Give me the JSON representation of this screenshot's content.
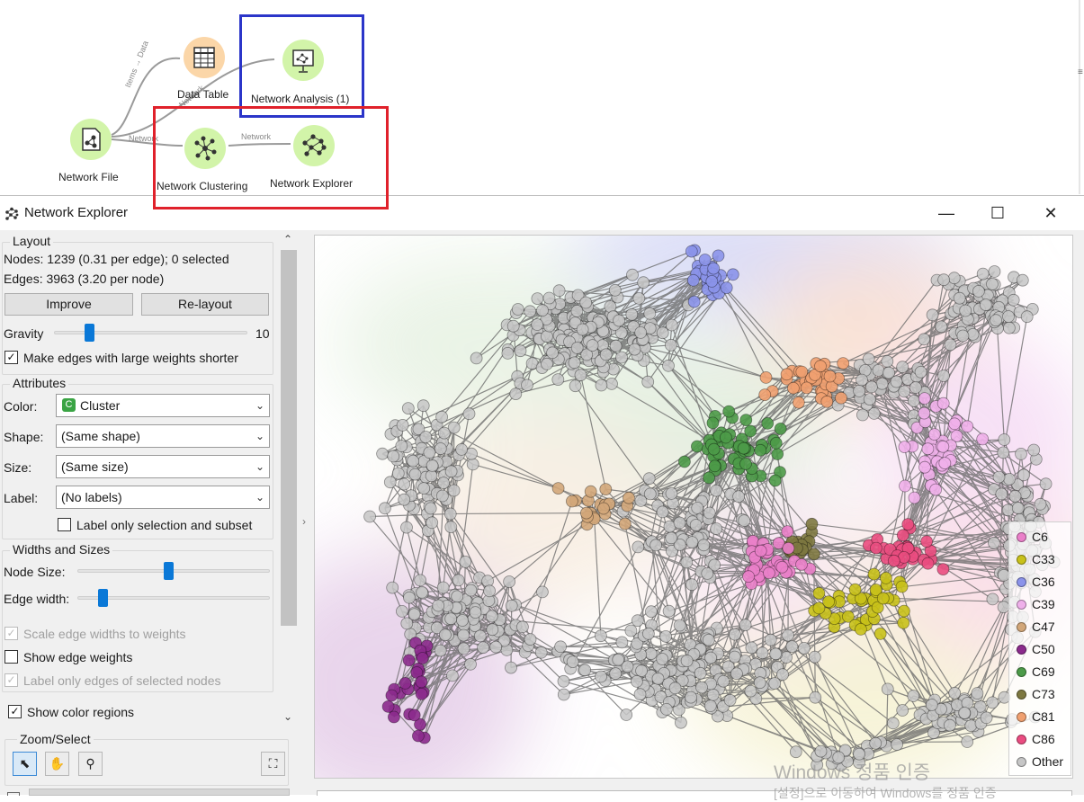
{
  "workflow": {
    "nodes": [
      {
        "label": "Data Table",
        "icon": "table-icon"
      },
      {
        "label": "Network Analysis (1)",
        "icon": "network-analysis-icon"
      },
      {
        "label": "Network File",
        "icon": "network-file-icon"
      },
      {
        "label": "Network Clustering",
        "icon": "network-clustering-icon"
      },
      {
        "label": "Network Explorer",
        "icon": "network-explorer-icon"
      }
    ],
    "links": {
      "file_to_table": "Items → Data",
      "file_to_analysis": "Network",
      "file_to_clustering": "Network",
      "clustering_to_explorer": "Network"
    },
    "highlight_colors": {
      "blue_box": "#2b35c9",
      "red_box": "#e0212b"
    }
  },
  "window": {
    "title": "Network Explorer",
    "icon": "network-explorer-icon",
    "controls": {
      "minimize": "—",
      "maximize": "☐",
      "close": "✕"
    }
  },
  "layout_box": {
    "title": "Layout",
    "nodes_info": "Nodes: 1239 (0.31 per edge); 0 selected",
    "edges_info": "Edges: 3963 (3.20 per node)",
    "improve_label": "Improve",
    "relayout_label": "Re-layout",
    "gravity_label": "Gravity",
    "gravity_value": "10",
    "gravity_fraction": 0.1,
    "shorter_edges_label": "Make edges with large weights shorter",
    "shorter_edges_checked": true
  },
  "attributes_box": {
    "title": "Attributes",
    "color_label": "Color:",
    "color_value": "Cluster",
    "color_badge": "C",
    "shape_label": "Shape:",
    "shape_value": "(Same shape)",
    "size_label": "Size:",
    "size_value": "(Same size)",
    "label_label": "Label:",
    "label_value": "(No labels)",
    "label_only_selection": "Label only selection and subset",
    "label_only_selection_checked": false
  },
  "widths_box": {
    "title": "Widths and Sizes",
    "node_size_label": "Node Size:",
    "node_size_fraction": 0.47,
    "edge_width_label": "Edge width:",
    "edge_width_fraction": 0.1,
    "scale_edges_label": "Scale edge widths to weights",
    "scale_edges_checked": true,
    "show_weights_label": "Show edge weights",
    "show_weights_checked": false,
    "label_edges_label": "Label only edges of selected nodes",
    "label_edges_checked": true
  },
  "show_color_regions": {
    "label": "Show color regions",
    "checked": true
  },
  "zoom_select": {
    "title": "Zoom/Select",
    "tools": [
      "select-arrow-icon",
      "pan-hand-icon",
      "zoom-magnifier-icon",
      "fit-view-icon"
    ]
  },
  "legend": [
    {
      "label": "C6",
      "color": "#ea7fc9"
    },
    {
      "label": "C33",
      "color": "#c8c11a"
    },
    {
      "label": "C36",
      "color": "#8b93ea"
    },
    {
      "label": "C39",
      "color": "#efb0ea"
    },
    {
      "label": "C47",
      "color": "#d2a679"
    },
    {
      "label": "C50",
      "color": "#8b2a8c"
    },
    {
      "label": "C69",
      "color": "#4c9a48"
    },
    {
      "label": "C73",
      "color": "#7d7840"
    },
    {
      "label": "C81",
      "color": "#f0a070"
    },
    {
      "label": "C86",
      "color": "#ea4c80"
    },
    {
      "label": "Other",
      "color": "#c6c6c6"
    }
  ],
  "watermark": {
    "line1": "Windows 정품 인증",
    "line2": "[설정]으로 이동하여 Windows를 정품 인증"
  }
}
